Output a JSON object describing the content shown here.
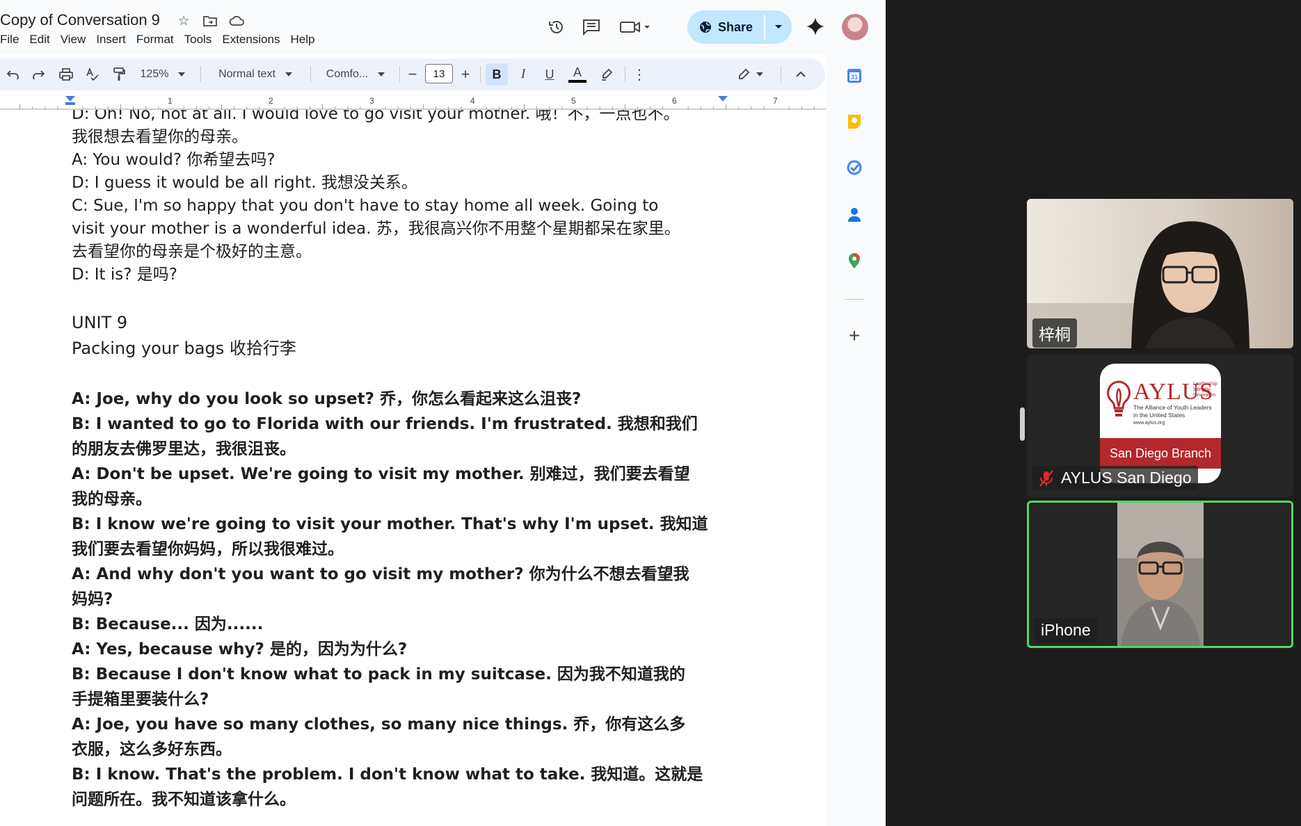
{
  "doc": {
    "title": "Copy of Conversation 9",
    "menu": [
      "File",
      "Edit",
      "View",
      "Insert",
      "Format",
      "Tools",
      "Extensions",
      "Help"
    ],
    "share_label": "Share",
    "toolbar": {
      "zoom": "125%",
      "style": "Normal text",
      "font": "Comfo...",
      "font_size": "13",
      "bold": "B",
      "italic": "I",
      "underline": "U",
      "text_color": "A"
    },
    "ruler_numbers": [
      "1",
      "2",
      "3",
      "4",
      "5",
      "6",
      "7"
    ],
    "lines_top": [
      "D: Oh! No, not at all. I would love to go visit your mother. 哦！不，一点也不。",
      "我很想去看望你的母亲。",
      "A: You would? 你希望去吗?",
      "D: I guess it would be all right. 我想没关系。",
      "C: Sue, I'm so happy that you don't have to stay home all week. Going to",
      "visit your mother is a wonderful idea. 苏，我很高兴你不用整个星期都呆在家里。",
      "去看望你的母亲是个极好的主意。",
      "D: It is? 是吗?"
    ],
    "unit_heading": "UNIT 9",
    "unit_subtitle": "Packing your bags 收拾行李",
    "lines_bold": [
      "A: Joe, why do you look so upset? 乔，你怎么看起来这么沮丧?",
      "B: I wanted to go to Florida with our friends. I'm frustrated. 我想和我们",
      "的朋友去佛罗里达，我很沮丧。",
      "A: Don't be upset. We're going to visit my mother. 别难过，我们要去看望",
      "我的母亲。",
      "B: I know we're going to visit your mother. That's why I'm upset. 我知道",
      "我们要去看望你妈妈，所以我很难过。",
      "A: And why don't you want to go visit my mother? 你为什么不想去看望我",
      "妈妈?",
      "B: Because... 因为......",
      "A: Yes, because why? 是的，因为为什么?",
      "B: Because I don't know what to pack in my suitcase. 因为我不知道我的",
      "手提箱里要装什么?",
      "A: Joe, you have so many clothes, so many nice things. 乔，你有这么多",
      "衣服，这么多好东西。",
      "B: I know. That's the problem. I don't know what to take. 我知道。这就是",
      "问题所在。我不知道该拿什么。"
    ]
  },
  "zoom": {
    "participants": [
      {
        "name": "梓桐",
        "muted": false
      },
      {
        "name": "AYLUS San Diego",
        "muted": true
      },
      {
        "name": "iPhone",
        "muted": false,
        "active_speaker": true
      }
    ],
    "aylus_logo": {
      "wordmark": "AYLUS",
      "taglines": [
        "Leadership",
        "Integrity",
        "Innovation"
      ],
      "full_name_1": "The Alliance of Youth Leaders",
      "full_name_2": "in the United States",
      "url": "www.aylus.org",
      "branch": "San Diego Branch"
    }
  },
  "colors": {
    "share_bg": "#c2e7ff",
    "toolbar_bg": "#edf2fa",
    "active_speaker_border": "#4cd964",
    "aylus_red": "#b3282d"
  }
}
